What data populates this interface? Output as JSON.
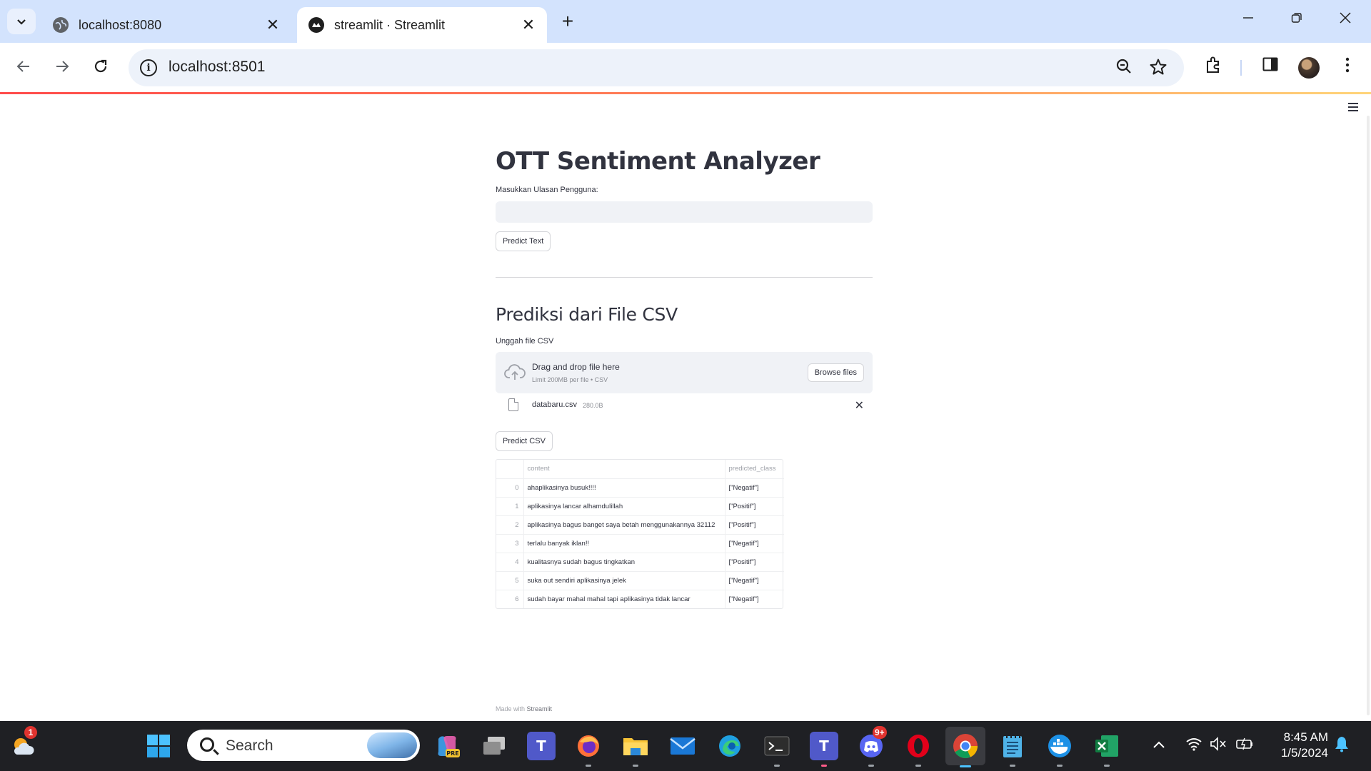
{
  "browser": {
    "tabs": [
      {
        "title": "localhost:8080",
        "active": false
      },
      {
        "title": "streamlit · Streamlit",
        "active": true
      }
    ],
    "close_glyph": "✕",
    "new_tab_glyph": "+",
    "url": "localhost:8501",
    "accent_color": "#d3e3fd"
  },
  "page": {
    "title": "OTT Sentiment Analyzer",
    "input_label": "Masukkan Ulasan Pengguna:",
    "input_value": "",
    "predict_text_button": "Predict Text",
    "section_title": "Prediksi dari File CSV",
    "upload_label": "Unggah file CSV",
    "uploader": {
      "drag_text": "Drag and drop file here",
      "limit_text": "Limit 200MB per file • CSV",
      "browse_button": "Browse files"
    },
    "uploaded_file": {
      "name": "databaru.csv",
      "size": "280.0B"
    },
    "predict_csv_button": "Predict CSV",
    "table": {
      "columns": [
        "",
        "content",
        "predicted_class"
      ],
      "rows": [
        {
          "index": "0",
          "content": "ahaplikasinya busuk!!!!",
          "predicted_class": "[\"Negatif\"]"
        },
        {
          "index": "1",
          "content": "aplikasinya lancar alhamdulillah",
          "predicted_class": "[\"Positif\"]"
        },
        {
          "index": "2",
          "content": "aplikasinya bagus banget saya betah menggunakannya 32112",
          "predicted_class": "[\"Positif\"]"
        },
        {
          "index": "3",
          "content": "terlalu banyak iklan!!",
          "predicted_class": "[\"Negatif\"]"
        },
        {
          "index": "4",
          "content": "kualitasnya sudah bagus tingkatkan",
          "predicted_class": "[\"Positif\"]"
        },
        {
          "index": "5",
          "content": "suka out sendiri aplikasinya jelek",
          "predicted_class": "[\"Negatif\"]"
        },
        {
          "index": "6",
          "content": "sudah bayar mahal mahal tapi aplikasinya tidak lancar",
          "predicted_class": "[\"Negatif\"]"
        }
      ]
    },
    "footer": {
      "prefix": "Made with",
      "brand": "Streamlit"
    }
  },
  "taskbar": {
    "weather_badge": "1",
    "search_placeholder": "Search",
    "discord_badge": "9+",
    "clock_time": "8:45 AM",
    "clock_date": "1/5/2024",
    "apps": [
      "copilot-icon",
      "task-view-icon",
      "teams-icon",
      "firefox-icon",
      "file-explorer-icon",
      "mail-icon",
      "edge-icon",
      "terminal-icon",
      "teams-icon",
      "discord-icon",
      "opera-icon",
      "chrome-icon",
      "notepad-icon",
      "docker-icon",
      "excel-icon"
    ]
  }
}
